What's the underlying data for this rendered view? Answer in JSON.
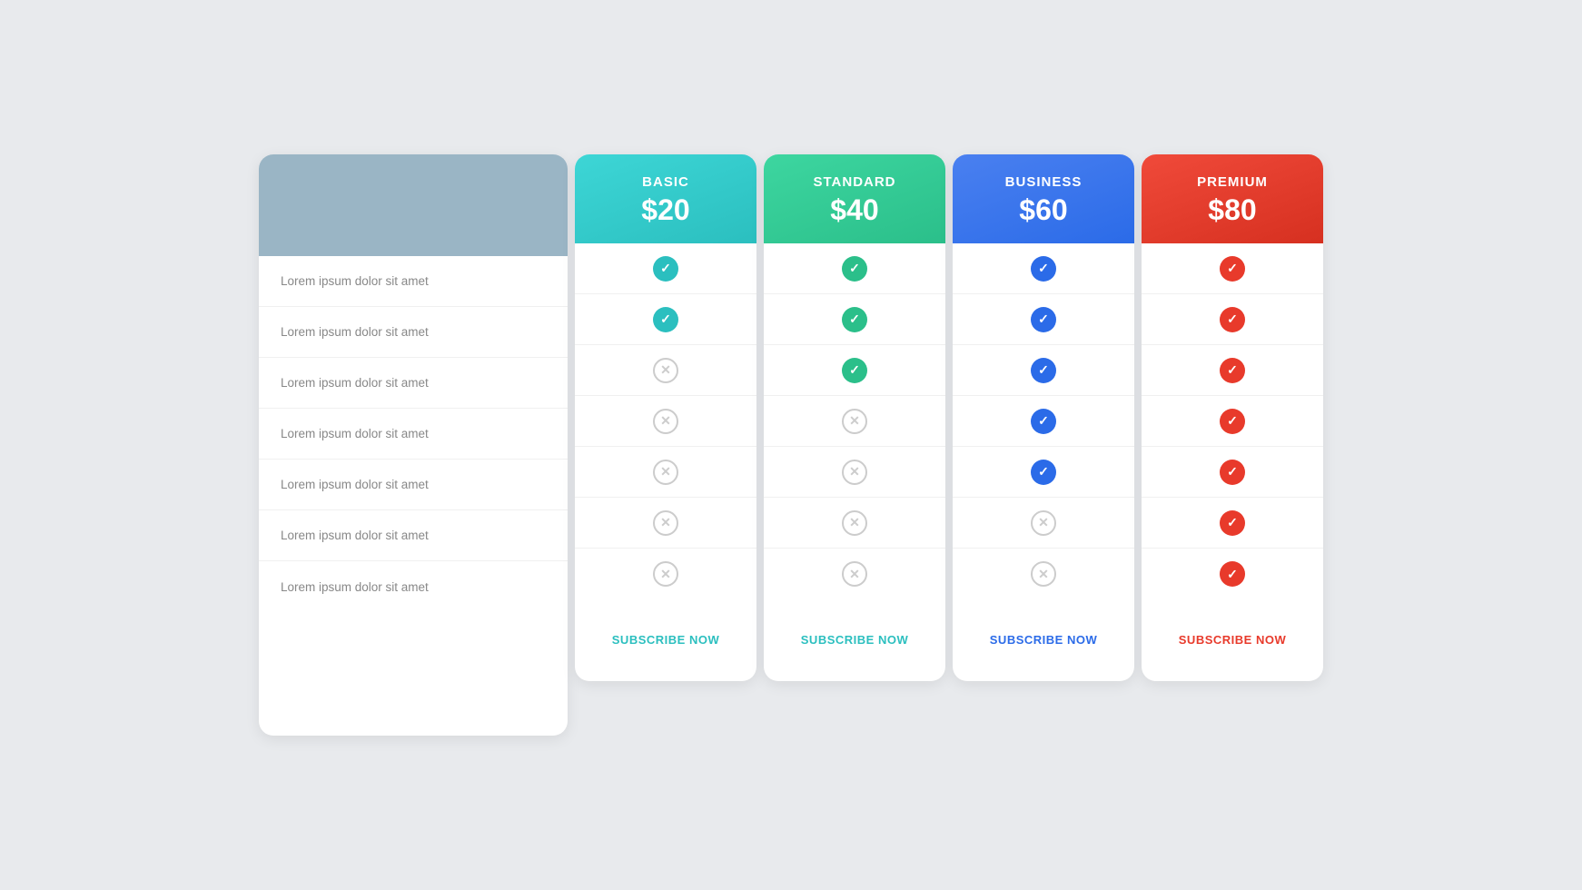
{
  "plans": [
    {
      "id": "basic",
      "name": "BASIC",
      "price": "$20",
      "header_class": "header-basic",
      "check_class": "check-yes-cyan",
      "subscribe_class": "subscribe-btn-cyan",
      "subscribe_label": "SUBSCRIBE NOW",
      "features": [
        true,
        true,
        false,
        false,
        false,
        false,
        false
      ]
    },
    {
      "id": "standard",
      "name": "STANDARD",
      "price": "$40",
      "header_class": "header-standard",
      "check_class": "check-yes-green",
      "subscribe_class": "subscribe-btn-cyan",
      "subscribe_label": "SUBSCRIBE NOW",
      "features": [
        true,
        true,
        true,
        false,
        false,
        false,
        false
      ]
    },
    {
      "id": "business",
      "name": "BUSINESS",
      "price": "$60",
      "header_class": "header-business",
      "check_class": "check-yes-blue",
      "subscribe_class": "subscribe-btn-blue",
      "subscribe_label": "SUBSCRIBE NOW",
      "features": [
        true,
        true,
        true,
        true,
        true,
        false,
        false
      ]
    },
    {
      "id": "premium",
      "name": "PREMIUM",
      "price": "$80",
      "header_class": "header-premium",
      "check_class": "check-yes-red",
      "subscribe_class": "subscribe-btn-red",
      "subscribe_label": "SUBSCRIBE NOW",
      "features": [
        true,
        true,
        true,
        true,
        true,
        true,
        true
      ]
    }
  ],
  "feature_labels": [
    "Lorem ipsum dolor sit amet",
    "Lorem ipsum dolor sit amet",
    "Lorem ipsum dolor sit amet",
    "Lorem ipsum dolor sit amet",
    "Lorem ipsum dolor sit amet",
    "Lorem ipsum dolor sit amet",
    "Lorem ipsum dolor sit amet"
  ]
}
